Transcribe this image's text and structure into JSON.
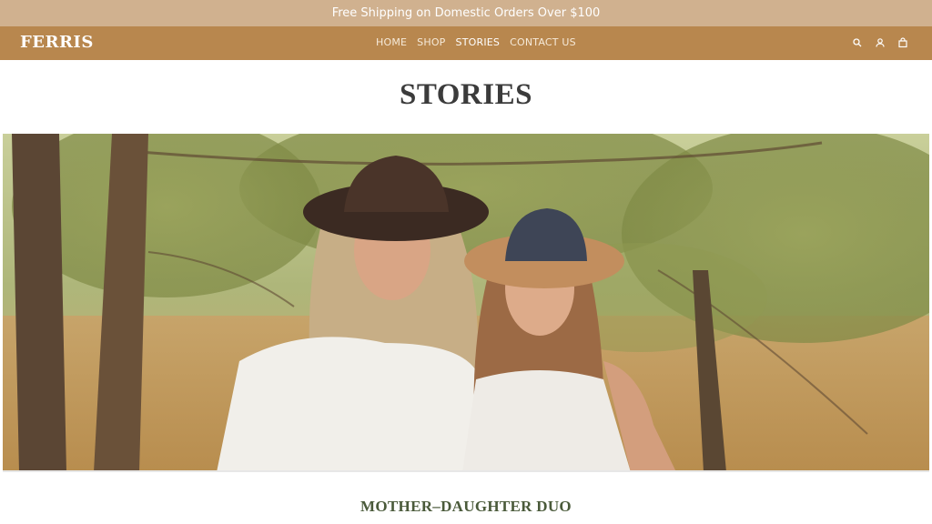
{
  "announcement": "Free Shipping on Domestic Orders Over $100",
  "brand": "FERRIS",
  "nav": {
    "items": [
      {
        "label": "HOME"
      },
      {
        "label": "SHOP"
      },
      {
        "label": "STORIES"
      },
      {
        "label": "CONTACT US"
      }
    ],
    "active": "STORIES",
    "icons": [
      "search-icon",
      "account-icon",
      "cart-icon"
    ]
  },
  "page": {
    "title": "STORIES",
    "hero_image": "photo of two smiling women in wide-brim hats under willow trees",
    "section_title": "MOTHER–DAUGHTER DUO"
  },
  "colors": {
    "announcement_bg": "#d0b18f",
    "navbar_bg": "#b8874e",
    "title_text": "#3b3b3b",
    "section_title_text": "#4a5a3a"
  }
}
